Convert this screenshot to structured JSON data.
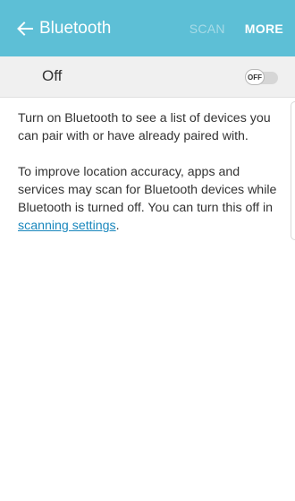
{
  "app_bar": {
    "title": "Bluetooth",
    "scan_label": "SCAN",
    "more_label": "MORE",
    "back_icon": "arrow-left-icon",
    "color": "#5dbfd6"
  },
  "master_switch": {
    "label": "Off",
    "toggle_text": "OFF",
    "state": "off"
  },
  "body": {
    "paragraph1": "Turn on Bluetooth to see a list of devices you can pair with or have already paired with.",
    "paragraph2_text": "To improve location accuracy, apps and services may scan for Bluetooth devices while Bluetooth is turned off. You can turn this off in ",
    "paragraph2_link": "scanning settings",
    "paragraph2_end": "."
  }
}
